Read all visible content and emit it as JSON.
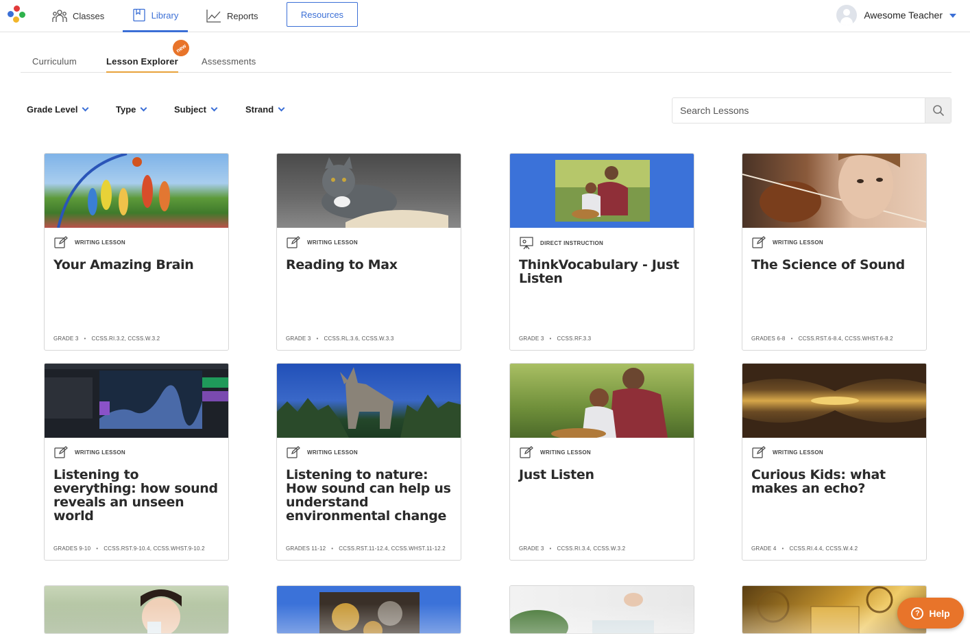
{
  "nav": {
    "items": [
      {
        "label": "Classes",
        "icon": "people-icon"
      },
      {
        "label": "Library",
        "icon": "book-icon",
        "active": true
      },
      {
        "label": "Reports",
        "icon": "chart-line-icon"
      }
    ],
    "resources_label": "Resources",
    "user_name": "Awesome Teacher"
  },
  "subtabs": {
    "items": [
      "Curriculum",
      "Lesson Explorer",
      "Assessments"
    ],
    "active": "Lesson Explorer",
    "new_badge": "new"
  },
  "filters": [
    "Grade Level",
    "Type",
    "Subject",
    "Strand"
  ],
  "search": {
    "placeholder": "Search Lessons",
    "value": ""
  },
  "cards": [
    {
      "type": "WRITING LESSON",
      "title": "Your Amazing Brain",
      "grade": "GRADE 3",
      "standards": "CCSS.RI.3.2, CCSS.W.3.2",
      "thumb": "basketball-photo"
    },
    {
      "type": "WRITING LESSON",
      "title": "Reading to Max",
      "grade": "GRADE 3",
      "standards": "CCSS.RL.3.6, CCSS.W.3.3",
      "thumb": "cat-book-photo"
    },
    {
      "type": "DIRECT INSTRUCTION",
      "title": "ThinkVocabulary - Just Listen",
      "grade": "GRADE 3",
      "standards": "CCSS.RF.3.3",
      "thumb": "father-child-photo"
    },
    {
      "type": "WRITING LESSON",
      "title": "The Science of Sound",
      "grade": "GRADES 6-8",
      "standards": "CCSS.RST.6-8.4, CCSS.WHST.6-8.2",
      "thumb": "violin-photo"
    },
    {
      "type": "WRITING LESSON",
      "title": "Listening to everything: how sound reveals an unseen world",
      "grade": "GRADES 9-10",
      "standards": "CCSS.RST.9-10.4, CCSS.WHST.9-10.2",
      "thumb": "audio-software-photo"
    },
    {
      "type": "WRITING LESSON",
      "title": "Listening to nature: How sound can help us understand environmental change",
      "grade": "GRADES 11-12",
      "standards": "CCSS.RST.11-12.4, CCSS.WHST.11-12.2",
      "thumb": "wolf-photo"
    },
    {
      "type": "WRITING LESSON",
      "title": "Just Listen",
      "grade": "GRADE 3",
      "standards": "CCSS.RI.3.4, CCSS.W.3.2",
      "thumb": "father-child-photo"
    },
    {
      "type": "WRITING LESSON",
      "title": "Curious Kids: what makes an echo?",
      "grade": "GRADE 4",
      "standards": "CCSS.RI.4.4, CCSS.W.4.2",
      "thumb": "cave-photo"
    }
  ],
  "partial_cards": [
    "girl-drinking-photo",
    "coins-photo",
    "cooking-photo",
    "gold-bars-photo"
  ],
  "help_label": "Help",
  "colors": {
    "accent": "#3b6fd6",
    "badge": "#e8742a",
    "tab_underline": "#e8a23a"
  }
}
